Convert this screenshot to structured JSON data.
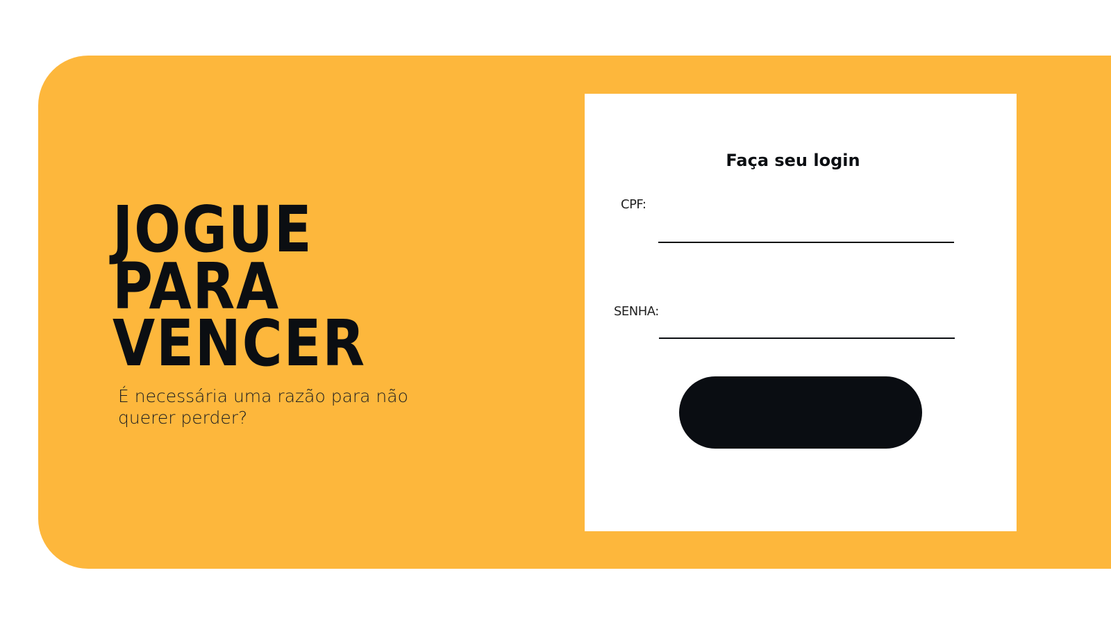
{
  "colors": {
    "banner": "#fdb73c",
    "text_dark": "#0b0e12",
    "card": "#ffffff",
    "button": "#0a0d12"
  },
  "hero": {
    "headline_lines": [
      "JOGUE",
      "PARA",
      "VENCER"
    ],
    "tagline": "É necessária uma razão para não querer perder?"
  },
  "login": {
    "title": "Faça seu login",
    "cpf_label": "CPF:",
    "cpf_value": "",
    "senha_label": "SENHA:",
    "senha_value": "",
    "button_label": ""
  }
}
